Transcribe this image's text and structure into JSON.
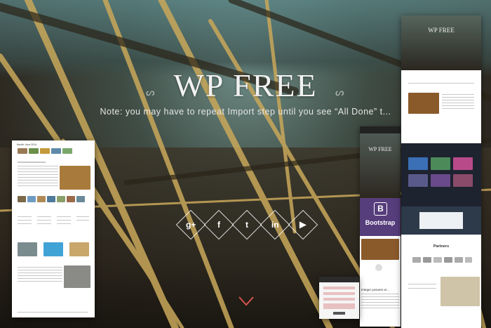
{
  "hero": {
    "title": "WP FREE",
    "subtitle": "Note: you may have to repeat   Import step until you see “All Done” t..."
  },
  "social_icons": [
    {
      "name": "google-plus-icon",
      "glyph": "g+"
    },
    {
      "name": "facebook-icon",
      "glyph": "f"
    },
    {
      "name": "twitter-icon",
      "glyph": "t"
    },
    {
      "name": "linkedin-icon",
      "glyph": "in"
    },
    {
      "name": "youtube-icon",
      "glyph": "▶"
    }
  ],
  "mockups": {
    "left_header": "Month: June 2014",
    "phone_title": "WP FREE",
    "bootstrap_label": "Bootstrap",
    "bootstrap_letter": "B",
    "phone_quote": "Integer posuere er...",
    "partners_heading": "Partners",
    "top_right_title": "WP FREE"
  },
  "colors": {
    "accent_red": "#d9534f",
    "bootstrap_purple": "#563d7c"
  }
}
